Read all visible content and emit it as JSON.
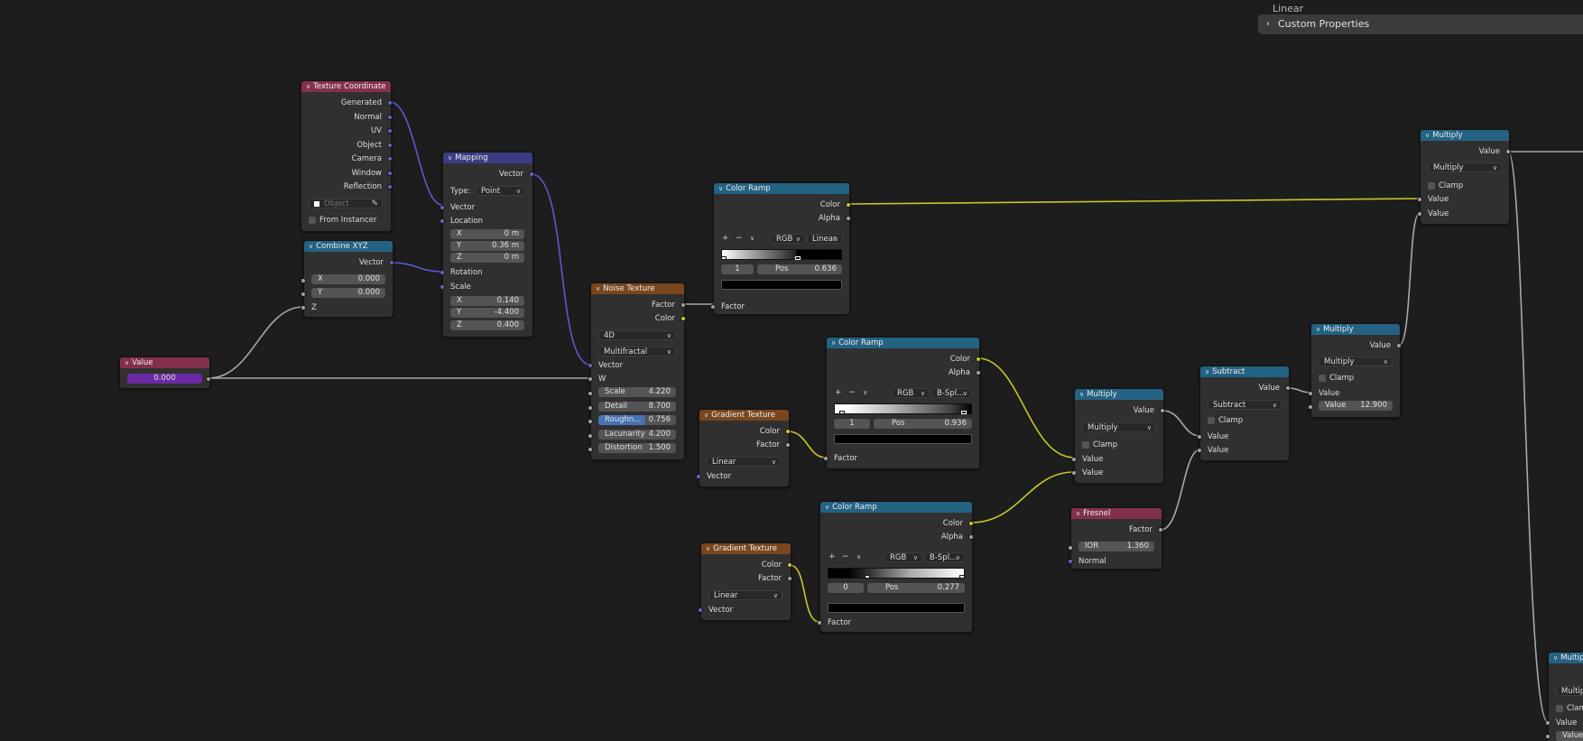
{
  "properties_panel": {
    "cut_label": "Linear",
    "section_label": "Custom Properties"
  },
  "colors": {
    "bg": "#1d1d1d",
    "node_body": "#303030",
    "header_input": "#83314a",
    "header_vector": "#3c3c83",
    "header_converter": "#246283",
    "header_texture": "#79461d",
    "socket_vector": "#6363c7",
    "socket_color": "#c7c729",
    "socket_float": "#a1a1a1",
    "field_active": "#4772b3",
    "value_purple": "#6a2aa3"
  },
  "nodes": {
    "texcoord": {
      "title": "Texture Coordinate",
      "outputs": [
        "Generated",
        "Normal",
        "UV",
        "Object",
        "Camera",
        "Window",
        "Reflection"
      ],
      "object_placeholder": "Object",
      "from_instancer": "From Instancer"
    },
    "mapping": {
      "title": "Mapping",
      "out": "Vector",
      "type_label": "Type:",
      "type_value": "Point",
      "in_vector": "Vector",
      "in_location": "Location",
      "loc": {
        "x_label": "X",
        "x": "0 m",
        "y_label": "Y",
        "y": "0.36 m",
        "z_label": "Z",
        "z": "0 m"
      },
      "in_rotation": "Rotation",
      "in_scale": "Scale",
      "scale": {
        "x_label": "X",
        "x": "0.140",
        "y_label": "Y",
        "y": "-4.400",
        "z_label": "Z",
        "z": "0.400"
      }
    },
    "combine": {
      "title": "Combine XYZ",
      "out": "Vector",
      "x_label": "X",
      "x": "0.000",
      "y_label": "Y",
      "y": "0.000",
      "z_label": "Z"
    },
    "value": {
      "title": "Value",
      "value": "0.000"
    },
    "noise": {
      "title": "Noise Texture",
      "out_factor": "Factor",
      "out_color": "Color",
      "dim": "4D",
      "type": "Multifractal",
      "in_vector": "Vector",
      "in_w": "W",
      "scale_label": "Scale",
      "scale": "4.220",
      "detail_label": "Detail",
      "detail": "8.700",
      "rough_label": "Roughn...",
      "rough": "0.756",
      "lac_label": "Lacunarity",
      "lac": "4.200",
      "dist_label": "Distortion",
      "dist": "1.500"
    },
    "ramp1": {
      "title": "Color Ramp",
      "out_color": "Color",
      "out_alpha": "Alpha",
      "plus": "+",
      "minus": "−",
      "mode": "RGB",
      "interp": "Linear",
      "index": "1",
      "pos_label": "Pos",
      "pos": "0.636",
      "in_factor": "Factor"
    },
    "ramp2": {
      "title": "Color Ramp",
      "out_color": "Color",
      "out_alpha": "Alpha",
      "plus": "+",
      "minus": "−",
      "mode": "RGB",
      "interp": "B-Spl...",
      "index": "1",
      "pos_label": "Pos",
      "pos": "0.936",
      "in_factor": "Factor"
    },
    "ramp3": {
      "title": "Color Ramp",
      "out_color": "Color",
      "out_alpha": "Alpha",
      "plus": "+",
      "minus": "−",
      "mode": "RGB",
      "interp": "B-Spl...",
      "index": "0",
      "pos_label": "Pos",
      "pos": "0.277",
      "in_factor": "Factor"
    },
    "grad1": {
      "title": "Gradient Texture",
      "out_color": "Color",
      "out_factor": "Factor",
      "type": "Linear",
      "in_vector": "Vector"
    },
    "grad2": {
      "title": "Gradient Texture",
      "out_color": "Color",
      "out_factor": "Factor",
      "type": "Linear",
      "in_vector": "Vector"
    },
    "mult1": {
      "title": "Multiply",
      "out": "Value",
      "op": "Multiply",
      "clamp": "Clamp",
      "in1": "Value",
      "in2": "Value"
    },
    "fresnel": {
      "title": "Fresnel",
      "out": "Factor",
      "ior_label": "IOR",
      "ior": "1.360",
      "in_normal": "Normal"
    },
    "subtract": {
      "title": "Subtract",
      "out": "Value",
      "op": "Subtract",
      "clamp": "Clamp",
      "in1": "Value",
      "in2": "Value"
    },
    "mult2": {
      "title": "Multiply",
      "out": "Value",
      "op": "Multiply",
      "clamp": "Clamp",
      "in1": "Value",
      "val_label": "Value",
      "val": "12.900"
    },
    "mult3": {
      "title": "Multiply",
      "out": "Value",
      "op": "Multiply",
      "clamp": "Clamp",
      "in1": "Value",
      "in2": "Value"
    },
    "mult4": {
      "title": "Multipl",
      "op": "Multipli",
      "clamp": "Clamp",
      "in1": "Value",
      "in2": "Value"
    }
  }
}
